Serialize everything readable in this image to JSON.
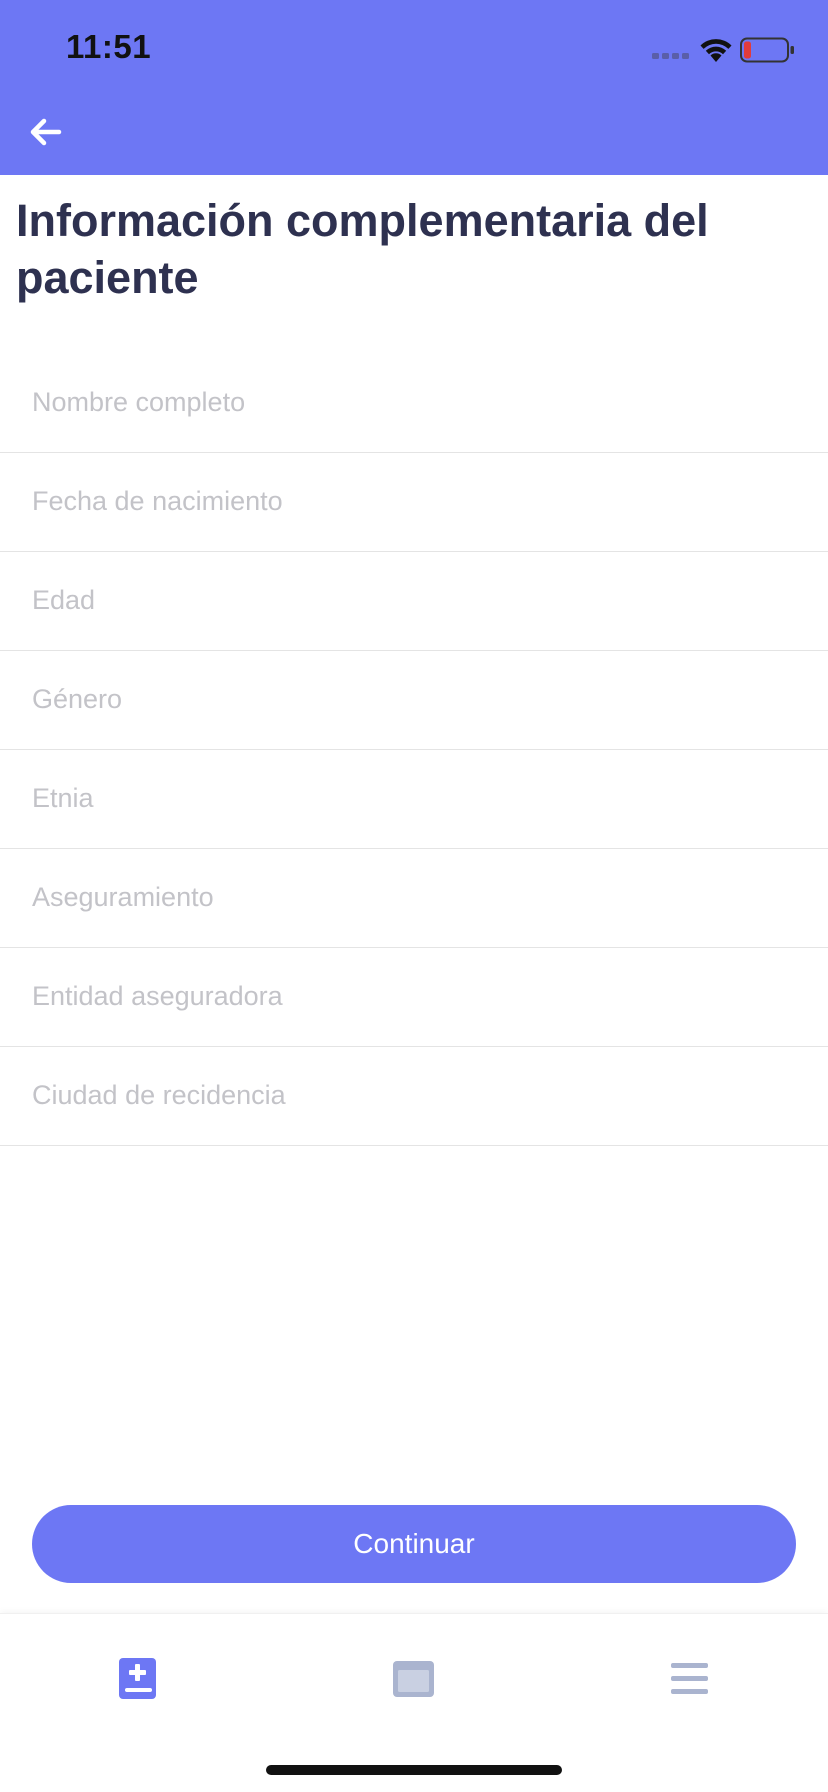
{
  "status_bar": {
    "time": "11:51"
  },
  "header": {
    "back_icon": "arrow-left-icon",
    "title": "Información complementaria del paciente"
  },
  "form": {
    "fields": [
      {
        "placeholder": "Nombre completo",
        "value": ""
      },
      {
        "placeholder": "Fecha de nacimiento",
        "value": ""
      },
      {
        "placeholder": "Edad",
        "value": ""
      },
      {
        "placeholder": "Género",
        "value": ""
      },
      {
        "placeholder": "Etnia",
        "value": ""
      },
      {
        "placeholder": "Aseguramiento",
        "value": ""
      },
      {
        "placeholder": "Entidad aseguradora",
        "value": ""
      },
      {
        "placeholder": "Ciudad de recidencia",
        "value": ""
      }
    ]
  },
  "actions": {
    "continue_label": "Continuar"
  },
  "tab_bar": {
    "items": [
      {
        "icon": "medical-book-icon",
        "active": true
      },
      {
        "icon": "card-icon",
        "active": false
      },
      {
        "icon": "menu-icon",
        "active": false
      }
    ]
  },
  "colors": {
    "primary": "#6d77f4",
    "title": "#2e3150",
    "placeholder": "#c3c3c8",
    "divider": "#e4e4e4",
    "tab_inactive": "#aab4cf",
    "battery_low": "#e23b3b"
  }
}
